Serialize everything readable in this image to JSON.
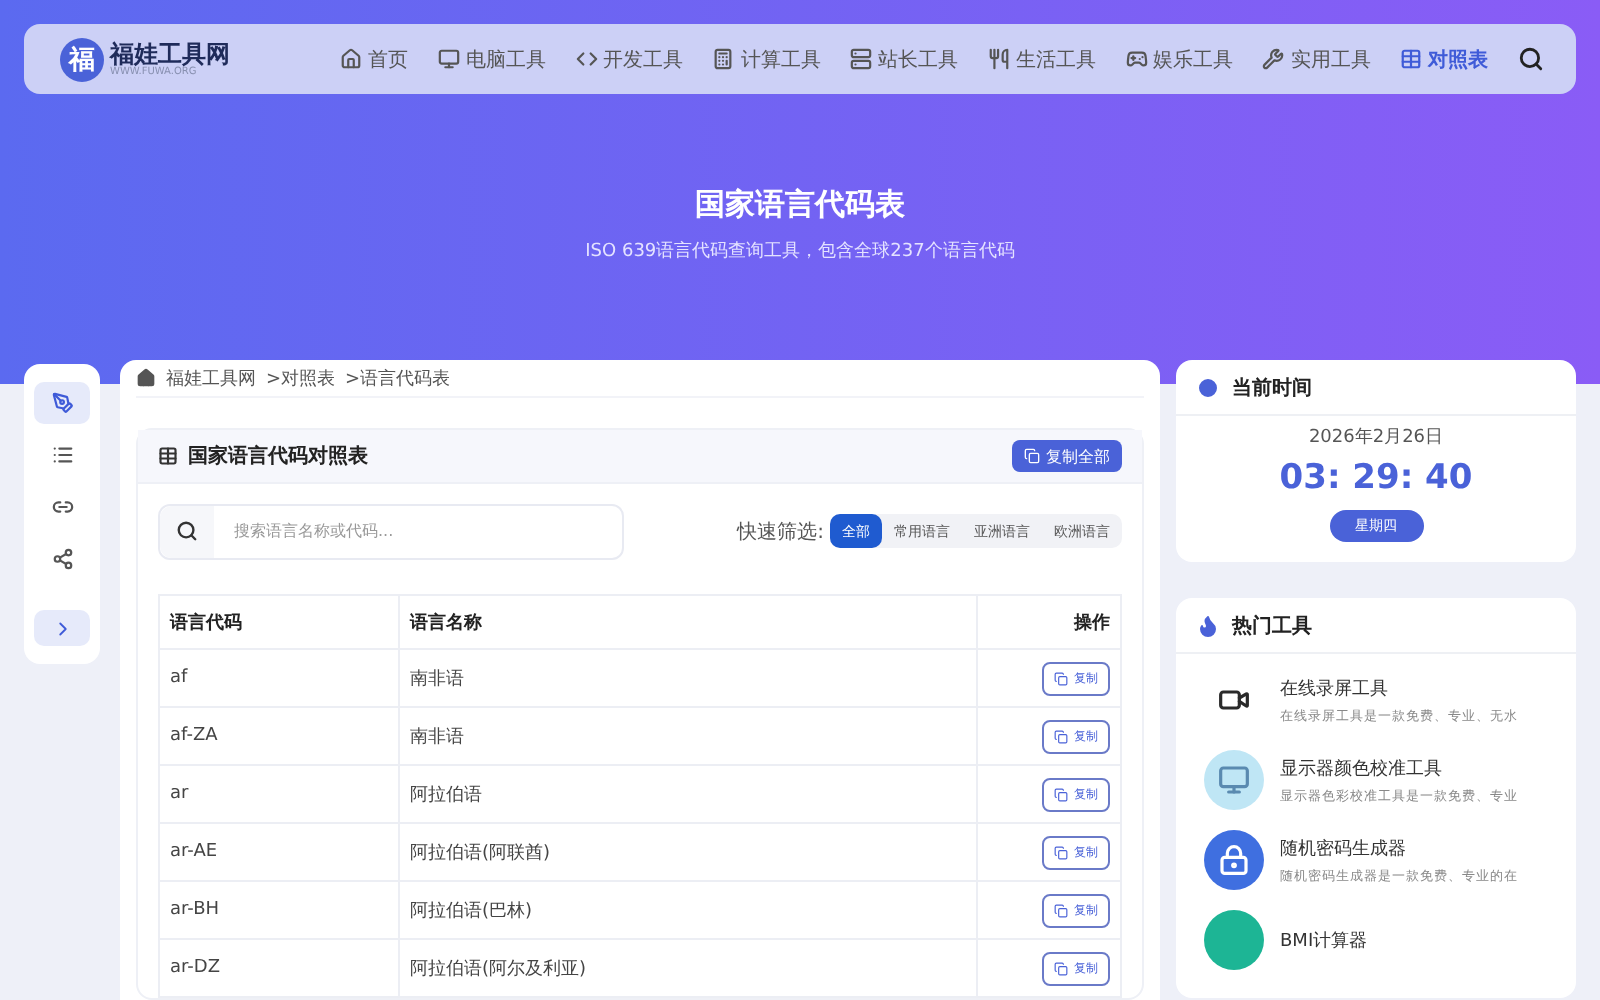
{
  "header": {
    "logo": {
      "title": "福娃工具网",
      "subtitle": "WWW.FUWA.ORG",
      "mark": "福"
    },
    "nav": [
      {
        "label": "首页",
        "selected": false
      },
      {
        "label": "电脑工具",
        "selected": false
      },
      {
        "label": "开发工具",
        "selected": false
      },
      {
        "label": "计算工具",
        "selected": false
      },
      {
        "label": "站长工具",
        "selected": false
      },
      {
        "label": "生活工具",
        "selected": false
      },
      {
        "label": "娱乐工具",
        "selected": false
      },
      {
        "label": "实用工具",
        "selected": false
      },
      {
        "label": "对照表",
        "selected": true
      }
    ]
  },
  "hero": {
    "title": "国家语言代码表",
    "subtitle": "ISO 639语言代码查询工具，包含全球237个语言代码"
  },
  "sidebar": {
    "items": [
      {
        "selected": true
      },
      {
        "selected": false
      },
      {
        "selected": false
      },
      {
        "selected": false
      }
    ]
  },
  "breadcrumb": [
    "福娃工具网",
    ">对照表",
    ">语言代码表"
  ],
  "panel": {
    "title": "国家语言代码对照表",
    "copy_all": "复制全部",
    "search": {
      "placeholder": "搜索语言名称或代码..."
    },
    "filter_label": "快速筛选:",
    "filters": [
      {
        "label": "全部",
        "selected": true
      },
      {
        "label": "常用语言",
        "selected": false
      },
      {
        "label": "亚洲语言",
        "selected": false
      },
      {
        "label": "欧洲语言",
        "selected": false
      }
    ],
    "table": {
      "columns": [
        "语言代码",
        "语言名称",
        "操作"
      ],
      "rows": [
        {
          "code": "af",
          "name": "南非语",
          "action": "复制"
        },
        {
          "code": "af-ZA",
          "name": "南非语",
          "action": "复制"
        },
        {
          "code": "ar",
          "name": "阿拉伯语",
          "action": "复制"
        },
        {
          "code": "ar-AE",
          "name": "阿拉伯语(阿联酋)",
          "action": "复制"
        },
        {
          "code": "ar-BH",
          "name": "阿拉伯语(巴林)",
          "action": "复制"
        },
        {
          "code": "ar-DZ",
          "name": "阿拉伯语(阿尔及利亚)",
          "action": "复制"
        }
      ]
    }
  },
  "clock": {
    "title": "当前时间",
    "date": "2026年2月26日",
    "time": "03: 29: 40",
    "weekday": "星期四"
  },
  "hot_tools": {
    "title": "热门工具",
    "items": [
      {
        "name": "在线录屏工具",
        "desc": "在线录屏工具是一款免费、专业、无水"
      },
      {
        "name": "显示器颜色校准工具",
        "desc": "显示器色彩校准工具是一款免费、专业"
      },
      {
        "name": "随机密码生成器",
        "desc": "随机密码生成器是一款免费、专业的在"
      },
      {
        "name": "BMI计算器"
      }
    ]
  }
}
